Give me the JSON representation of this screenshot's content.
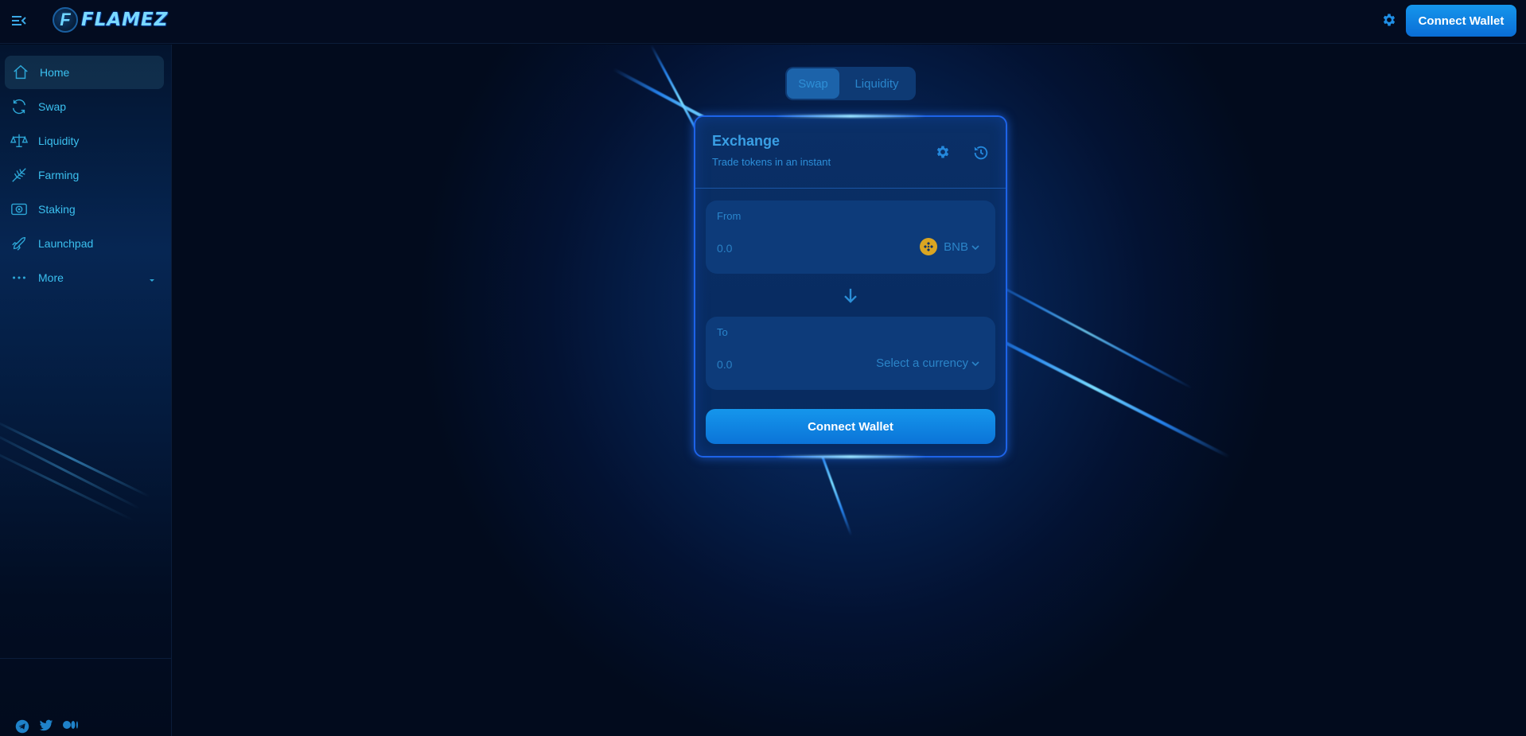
{
  "brand": {
    "logo_letter": "F",
    "logo_text": "FLAMEZ"
  },
  "header": {
    "connect_label": "Connect Wallet"
  },
  "sidebar": {
    "items": [
      {
        "label": "Home",
        "icon": "home-icon",
        "active": true
      },
      {
        "label": "Swap",
        "icon": "swap-icon",
        "active": false
      },
      {
        "label": "Liquidity",
        "icon": "liquidity-icon",
        "active": false
      },
      {
        "label": "Farming",
        "icon": "farming-icon",
        "active": false
      },
      {
        "label": "Staking",
        "icon": "staking-icon",
        "active": false
      },
      {
        "label": "Launchpad",
        "icon": "launchpad-icon",
        "active": false
      },
      {
        "label": "More",
        "icon": "more-icon",
        "active": false
      }
    ],
    "socials": [
      "telegram-icon",
      "twitter-icon",
      "medium-icon"
    ]
  },
  "tabs": [
    {
      "label": "Swap",
      "active": true
    },
    {
      "label": "Liquidity",
      "active": false
    }
  ],
  "exchange": {
    "title": "Exchange",
    "subtitle": "Trade tokens in an instant",
    "from": {
      "label": "From",
      "placeholder": "0.0",
      "token": "BNB"
    },
    "to": {
      "label": "To",
      "placeholder": "0.0",
      "token": "Select a currency"
    },
    "connect_label": "Connect Wallet"
  },
  "colors": {
    "accent": "#0a7ee0",
    "nav_text": "#3bc0ef",
    "card_border": "#1d63e8",
    "background": "#020b1d",
    "bnb": "#d9a522"
  }
}
